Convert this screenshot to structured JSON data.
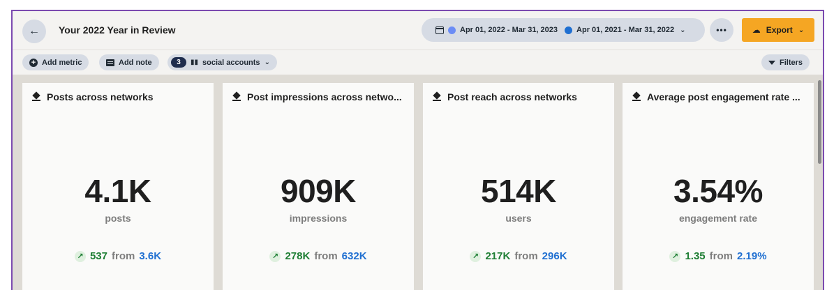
{
  "header": {
    "title": "Your 2022 Year in Review",
    "back_icon": "arrow-left-icon",
    "date_range": {
      "primary": "Apr 01, 2022 - Mar 31, 2023",
      "comparison": "Apr 01, 2021 - Mar 31, 2022",
      "primary_color": "#6b8cf5",
      "comparison_color": "#1f6fd1"
    },
    "more_label": "•••",
    "export_label": "Export",
    "export_color": "#f5a623"
  },
  "toolbar": {
    "add_metric": "Add metric",
    "add_note": "Add note",
    "social_count": "3",
    "social_label": "social accounts",
    "filters": "Filters"
  },
  "cards": [
    {
      "title": "Posts across networks",
      "value": "4.1K",
      "unit": "posts",
      "delta": "537",
      "from": "from",
      "previous": "3.6K"
    },
    {
      "title": "Post impressions across netwo...",
      "value": "909K",
      "unit": "impressions",
      "delta": "278K",
      "from": "from",
      "previous": "632K"
    },
    {
      "title": "Post reach across networks",
      "value": "514K",
      "unit": "users",
      "delta": "217K",
      "from": "from",
      "previous": "296K"
    },
    {
      "title": "Average post engagement rate ...",
      "value": "3.54%",
      "unit": "engagement rate",
      "delta": "1.35",
      "from": "from",
      "previous": "2.19%"
    }
  ],
  "colors": {
    "positive": "#1e7e34",
    "previous": "#1f6fd1",
    "accent_border": "#7b4ab0"
  }
}
